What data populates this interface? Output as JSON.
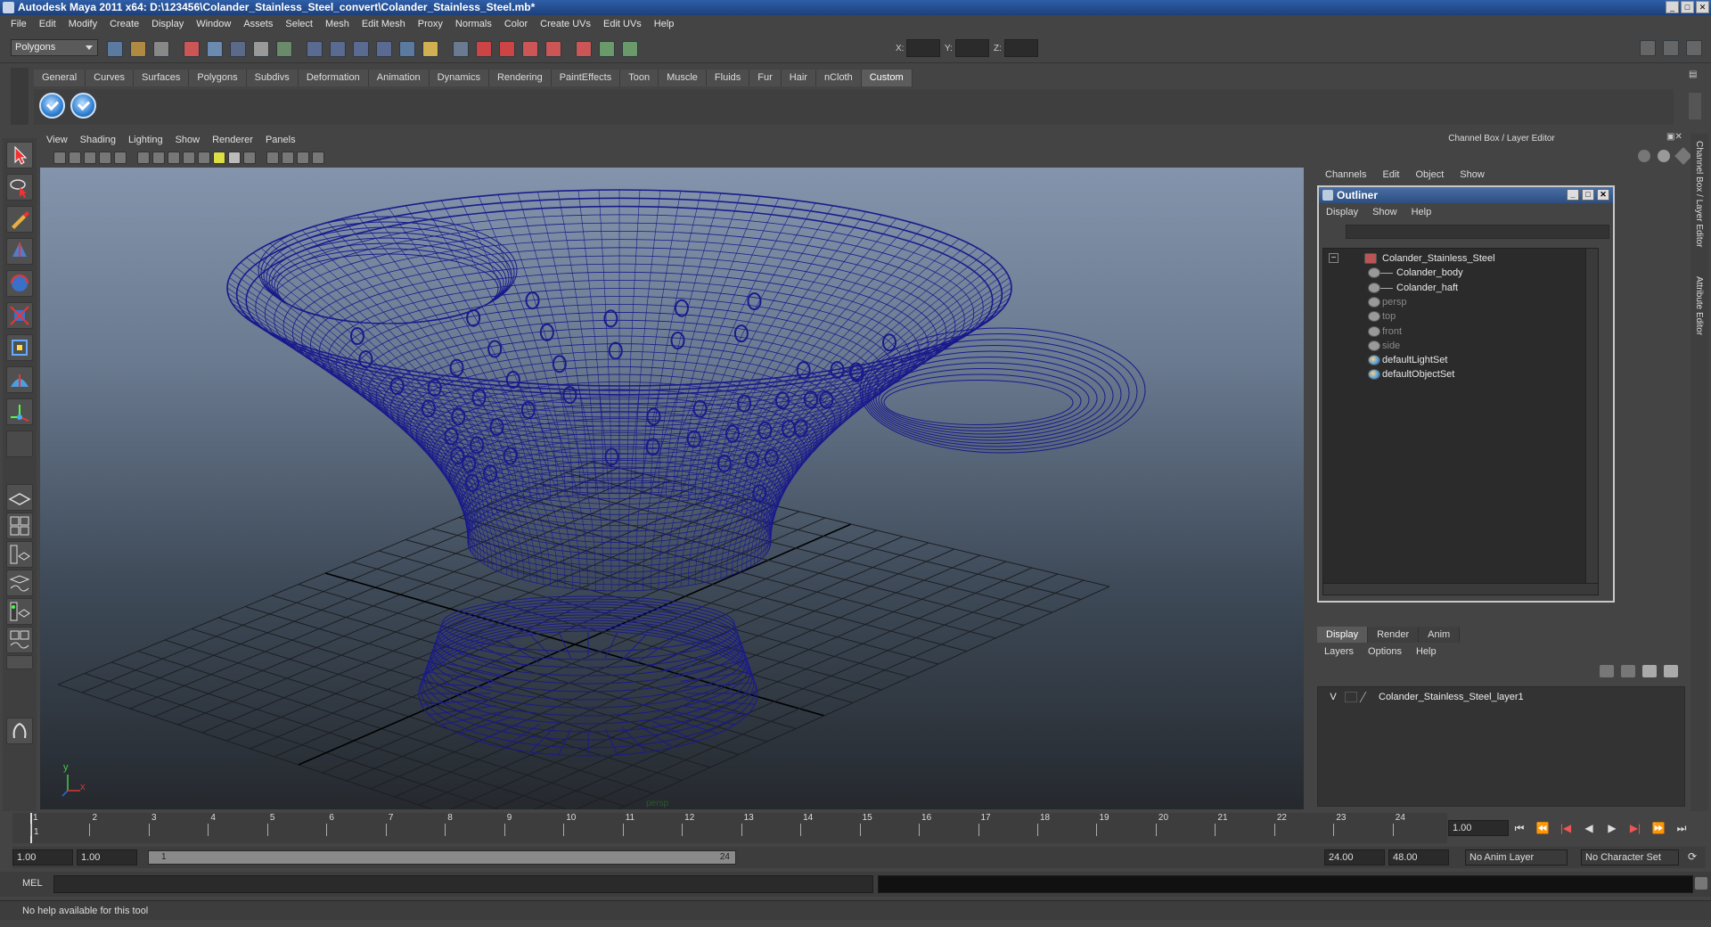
{
  "window": {
    "title": "Autodesk Maya 2011 x64: D:\\123456\\Colander_Stainless_Steel_convert\\Colander_Stainless_Steel.mb*"
  },
  "menu": [
    "File",
    "Edit",
    "Modify",
    "Create",
    "Display",
    "Window",
    "Assets",
    "Select",
    "Mesh",
    "Edit Mesh",
    "Proxy",
    "Normals",
    "Color",
    "Create UVs",
    "Edit UVs",
    "Help"
  ],
  "toolbar": {
    "mode": "Polygons",
    "coord_x_label": "X:",
    "coord_y_label": "Y:",
    "coord_z_label": "Z:"
  },
  "shelf": {
    "tabs": [
      "General",
      "Curves",
      "Surfaces",
      "Polygons",
      "Subdivs",
      "Deformation",
      "Animation",
      "Dynamics",
      "Rendering",
      "PaintEffects",
      "Toon",
      "Muscle",
      "Fluids",
      "Fur",
      "Hair",
      "nCloth",
      "Custom"
    ],
    "active": "Custom"
  },
  "panel_menu": [
    "View",
    "Shading",
    "Lighting",
    "Show",
    "Renderer",
    "Panels"
  ],
  "viewport": {
    "camera_label": "persp",
    "axis_y": "y",
    "axis_x": "x",
    "wire_color": "#1a1a8c"
  },
  "channel_box": {
    "title": "Channel Box / Layer Editor",
    "menu": [
      "Channels",
      "Edit",
      "Object",
      "Show"
    ]
  },
  "outliner": {
    "title": "Outliner",
    "menu": [
      "Display",
      "Show",
      "Help"
    ],
    "items": [
      {
        "label": "Colander_Stainless_Steel",
        "dim": false
      },
      {
        "label": "Colander_body",
        "dim": false
      },
      {
        "label": "Colander_haft",
        "dim": false
      },
      {
        "label": "persp",
        "dim": true
      },
      {
        "label": "top",
        "dim": true
      },
      {
        "label": "front",
        "dim": true
      },
      {
        "label": "side",
        "dim": true
      },
      {
        "label": "defaultLightSet",
        "dim": false
      },
      {
        "label": "defaultObjectSet",
        "dim": false
      }
    ]
  },
  "layer_editor": {
    "tabs": [
      "Display",
      "Render",
      "Anim"
    ],
    "active": "Display",
    "menu": [
      "Layers",
      "Options",
      "Help"
    ],
    "layer_visible": "V",
    "layer_name": "Colander_Stainless_Steel_layer1"
  },
  "time_slider": {
    "ticks": [
      "1",
      "2",
      "3",
      "4",
      "5",
      "6",
      "7",
      "8",
      "9",
      "10",
      "11",
      "12",
      "13",
      "14",
      "15",
      "16",
      "17",
      "18",
      "19",
      "20",
      "21",
      "22",
      "23",
      "24"
    ],
    "current_frame_label": "1",
    "current_time": "1.00"
  },
  "range": {
    "start": "1.00",
    "playback_start": "1.00",
    "slider_start": "1",
    "slider_end": "24",
    "playback_end": "24.00",
    "end": "48.00",
    "anim_layer": "No Anim Layer",
    "character_set": "No Character Set"
  },
  "command_line": {
    "label": "MEL"
  },
  "help_line": {
    "text": "No help available for this tool"
  },
  "side_tabs": [
    "Channel Box / Layer Editor",
    "Attribute Editor"
  ]
}
